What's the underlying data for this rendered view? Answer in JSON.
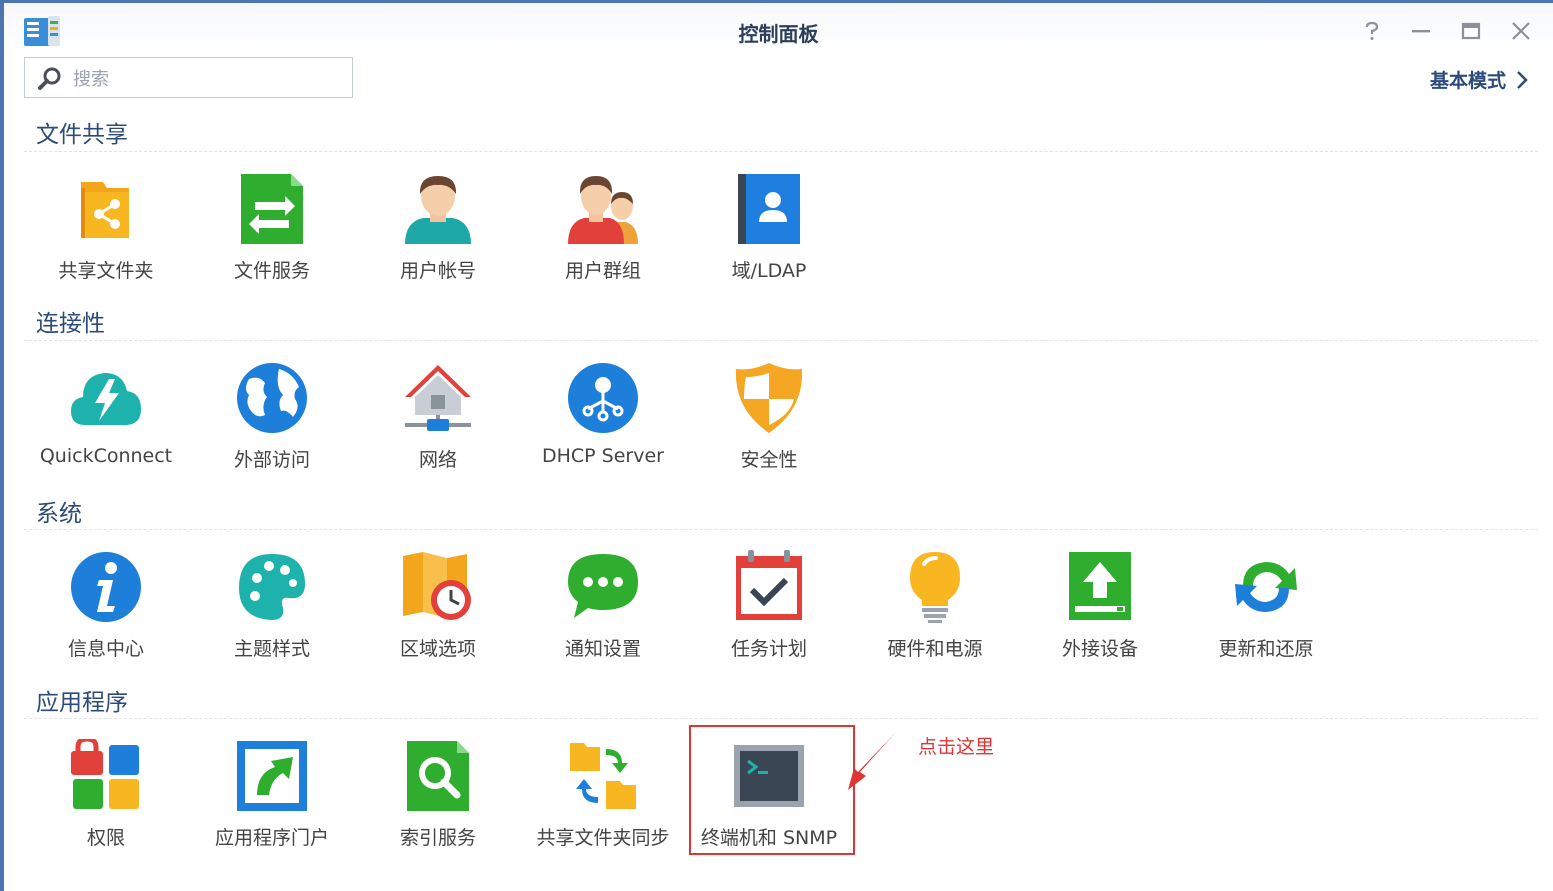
{
  "window": {
    "title": "控制面板"
  },
  "search": {
    "placeholder": "搜索"
  },
  "basic_mode_label": "基本模式",
  "sections": [
    {
      "title": "文件共享",
      "items": [
        "共享文件夹",
        "文件服务",
        "用户帐号",
        "用户群组",
        "域/LDAP"
      ]
    },
    {
      "title": "连接性",
      "items": [
        "QuickConnect",
        "外部访问",
        "网络",
        "DHCP Server",
        "安全性"
      ]
    },
    {
      "title": "系统",
      "items": [
        "信息中心",
        "主题样式",
        "区域选项",
        "通知设置",
        "任务计划",
        "硬件和电源",
        "外接设备",
        "更新和还原"
      ]
    },
    {
      "title": "应用程序",
      "items": [
        "权限",
        "应用程序门户",
        "索引服务",
        "共享文件夹同步",
        "终端机和 SNMP"
      ]
    }
  ],
  "annotation": {
    "text": "点击这里",
    "color": "#e03535"
  },
  "colors": {
    "frame": "#4d76b0",
    "heading": "#2c4a7a",
    "accent_red": "#e03535"
  }
}
